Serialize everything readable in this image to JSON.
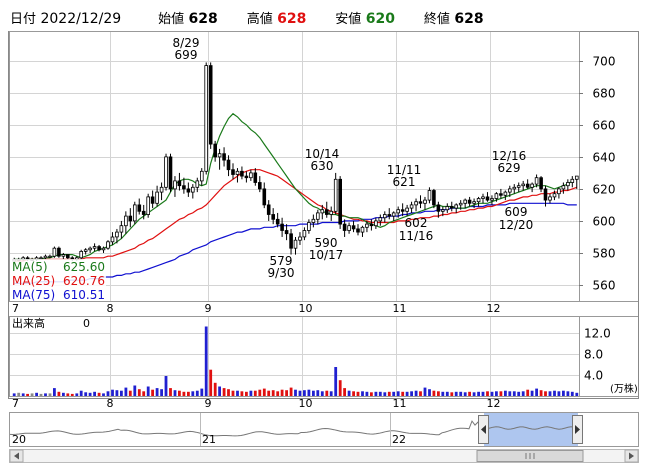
{
  "header": {
    "date_label": "日付",
    "date_value": "2022/12/29",
    "open_label": "始値",
    "open_value": "628",
    "high_label": "高値",
    "high_value": "628",
    "low_label": "安値",
    "low_value": "620",
    "close_label": "終値",
    "close_value": "628"
  },
  "colors": {
    "up": "#1e1e9a",
    "down": "#000000",
    "ma5": "#1a7a1a",
    "ma25": "#e01010",
    "ma75": "#1010d0",
    "vol_up": "#2020d0",
    "vol_down": "#e01010",
    "vol_flat": "#888888",
    "navigator_fill": "#aec6ef",
    "navigator_line": "#777777"
  },
  "legend": {
    "ma5_label": "MA(5)",
    "ma5_value": "625.60",
    "ma25_label": "MA(25)",
    "ma25_value": "620.76",
    "ma75_label": "MA(75)",
    "ma75_value": "610.51"
  },
  "volume": {
    "label": "出来高",
    "value": "0",
    "unit": "(万株)",
    "ticks": [
      "4.0",
      "8.0",
      "12.0"
    ]
  },
  "navigator": {
    "years": [
      "20",
      "21",
      "22"
    ]
  },
  "annotations": [
    {
      "id": "a-aug29",
      "date": "8/29",
      "value": "699"
    },
    {
      "id": "a-oct14",
      "date": "10/14",
      "value": "630"
    },
    {
      "id": "a-nov11",
      "date": "11/11",
      "value": "621"
    },
    {
      "id": "a-dec16",
      "date": "12/16",
      "value": "629"
    },
    {
      "id": "a-sep30",
      "date": "9/30",
      "value": "579"
    },
    {
      "id": "a-oct17",
      "date": "10/17",
      "value": "590"
    },
    {
      "id": "a-nov16",
      "date": "11/16",
      "value": "602"
    },
    {
      "id": "a-dec20",
      "date": "12/20",
      "value": "609"
    }
  ],
  "chart_data": {
    "type": "candlestick",
    "x_axis_labels": [
      "7",
      "8",
      "9",
      "10",
      "11",
      "12"
    ],
    "month_start_index": [
      0,
      22,
      44,
      65,
      86,
      107
    ],
    "y_ticks": [
      560,
      580,
      600,
      620,
      640,
      660,
      680,
      700
    ],
    "ylim": [
      550,
      718
    ],
    "grid": true,
    "candles": [
      [
        575,
        577,
        574,
        576
      ],
      [
        576,
        577,
        575,
        576
      ],
      [
        576,
        578,
        575,
        577
      ],
      [
        577,
        578,
        575,
        576
      ],
      [
        576,
        577,
        575,
        576
      ],
      [
        576,
        578,
        575,
        577
      ],
      [
        577,
        578,
        576,
        577
      ],
      [
        577,
        579,
        576,
        578
      ],
      [
        578,
        579,
        577,
        578
      ],
      [
        578,
        584,
        577,
        583
      ],
      [
        583,
        584,
        577,
        578
      ],
      [
        578,
        580,
        576,
        579
      ],
      [
        579,
        579,
        576,
        577
      ],
      [
        577,
        578,
        575,
        576
      ],
      [
        576,
        578,
        575,
        577
      ],
      [
        577,
        582,
        576,
        581
      ],
      [
        581,
        583,
        579,
        582
      ],
      [
        582,
        584,
        580,
        583
      ],
      [
        583,
        586,
        581,
        584
      ],
      [
        584,
        585,
        581,
        582
      ],
      [
        582,
        584,
        580,
        583
      ],
      [
        583,
        588,
        582,
        587
      ],
      [
        587,
        593,
        585,
        590
      ],
      [
        590,
        595,
        586,
        593
      ],
      [
        593,
        600,
        589,
        597
      ],
      [
        597,
        606,
        592,
        603
      ],
      [
        603,
        608,
        596,
        600
      ],
      [
        600,
        612,
        598,
        610
      ],
      [
        610,
        614,
        604,
        606
      ],
      [
        606,
        610,
        601,
        604
      ],
      [
        604,
        617,
        602,
        615
      ],
      [
        615,
        619,
        608,
        611
      ],
      [
        611,
        622,
        609,
        618
      ],
      [
        618,
        624,
        613,
        621
      ],
      [
        621,
        642,
        619,
        640
      ],
      [
        640,
        642,
        618,
        620
      ],
      [
        620,
        628,
        615,
        625
      ],
      [
        625,
        630,
        619,
        622
      ],
      [
        622,
        627,
        617,
        620
      ],
      [
        620,
        624,
        615,
        618
      ],
      [
        618,
        623,
        614,
        621
      ],
      [
        621,
        627,
        618,
        625
      ],
      [
        625,
        633,
        622,
        631
      ],
      [
        631,
        699,
        629,
        697
      ],
      [
        697,
        699,
        645,
        648
      ],
      [
        648,
        650,
        637,
        640
      ],
      [
        640,
        645,
        632,
        642
      ],
      [
        642,
        646,
        634,
        638
      ],
      [
        638,
        641,
        628,
        632
      ],
      [
        632,
        636,
        626,
        629
      ],
      [
        629,
        633,
        624,
        631
      ],
      [
        631,
        634,
        626,
        628
      ],
      [
        628,
        631,
        624,
        627
      ],
      [
        627,
        632,
        625,
        630
      ],
      [
        630,
        633,
        622,
        624
      ],
      [
        624,
        628,
        618,
        620
      ],
      [
        620,
        624,
        608,
        610
      ],
      [
        610,
        613,
        600,
        604
      ],
      [
        604,
        608,
        598,
        601
      ],
      [
        601,
        605,
        596,
        598
      ],
      [
        598,
        602,
        590,
        594
      ],
      [
        594,
        598,
        588,
        592
      ],
      [
        592,
        595,
        579,
        583
      ],
      [
        583,
        590,
        579,
        588
      ],
      [
        588,
        593,
        585,
        590
      ],
      [
        590,
        596,
        588,
        594
      ],
      [
        594,
        601,
        592,
        599
      ],
      [
        599,
        604,
        596,
        601
      ],
      [
        601,
        607,
        598,
        605
      ],
      [
        605,
        610,
        601,
        607
      ],
      [
        607,
        612,
        602,
        604
      ],
      [
        604,
        609,
        600,
        606
      ],
      [
        606,
        630,
        604,
        626
      ],
      [
        626,
        628,
        595,
        598
      ],
      [
        598,
        601,
        590,
        594
      ],
      [
        594,
        599,
        592,
        597
      ],
      [
        597,
        600,
        593,
        595
      ],
      [
        595,
        598,
        591,
        593
      ],
      [
        593,
        597,
        590,
        596
      ],
      [
        596,
        600,
        593,
        598
      ],
      [
        598,
        601,
        594,
        597
      ],
      [
        597,
        602,
        595,
        600
      ],
      [
        600,
        604,
        597,
        602
      ],
      [
        602,
        606,
        599,
        604
      ],
      [
        604,
        608,
        601,
        603
      ],
      [
        603,
        606,
        600,
        605
      ],
      [
        605,
        609,
        602,
        607
      ],
      [
        607,
        611,
        603,
        606
      ],
      [
        606,
        610,
        603,
        608
      ],
      [
        608,
        612,
        605,
        610
      ],
      [
        610,
        614,
        606,
        612
      ],
      [
        612,
        616,
        608,
        611
      ],
      [
        611,
        615,
        607,
        613
      ],
      [
        613,
        621,
        611,
        619
      ],
      [
        619,
        620,
        608,
        610
      ],
      [
        610,
        612,
        602,
        606
      ],
      [
        606,
        609,
        603,
        607
      ],
      [
        607,
        611,
        605,
        609
      ],
      [
        609,
        612,
        606,
        608
      ],
      [
        608,
        611,
        605,
        610
      ],
      [
        610,
        613,
        607,
        611
      ],
      [
        611,
        614,
        608,
        613
      ],
      [
        613,
        615,
        609,
        611
      ],
      [
        611,
        614,
        608,
        612
      ],
      [
        612,
        615,
        609,
        614
      ],
      [
        614,
        617,
        611,
        615
      ],
      [
        615,
        618,
        612,
        613
      ],
      [
        613,
        616,
        610,
        614
      ],
      [
        614,
        618,
        612,
        617
      ],
      [
        617,
        620,
        614,
        616
      ],
      [
        616,
        619,
        613,
        618
      ],
      [
        618,
        622,
        615,
        620
      ],
      [
        620,
        623,
        617,
        621
      ],
      [
        621,
        624,
        618,
        622
      ],
      [
        622,
        625,
        619,
        623
      ],
      [
        623,
        626,
        620,
        621
      ],
      [
        621,
        624,
        618,
        623
      ],
      [
        623,
        629,
        621,
        627
      ],
      [
        627,
        628,
        618,
        620
      ],
      [
        620,
        622,
        609,
        613
      ],
      [
        613,
        617,
        611,
        615
      ],
      [
        615,
        619,
        613,
        617
      ],
      [
        617,
        621,
        614,
        620
      ],
      [
        620,
        624,
        617,
        622
      ],
      [
        622,
        626,
        619,
        624
      ],
      [
        624,
        628,
        621,
        626
      ],
      [
        626,
        628,
        620,
        628
      ]
    ],
    "ma5": [
      576,
      576,
      576,
      576,
      576,
      576,
      576,
      577,
      577,
      578,
      579,
      579,
      579,
      579,
      578,
      577,
      578,
      579,
      581,
      582,
      583,
      584,
      585,
      587,
      589,
      592,
      595,
      598,
      601,
      603,
      605,
      607,
      609,
      611,
      613,
      618,
      623,
      625,
      626,
      626,
      625,
      623,
      622,
      623,
      636,
      645,
      653,
      659,
      664,
      667,
      665,
      662,
      660,
      657,
      655,
      652,
      648,
      644,
      640,
      636,
      632,
      628,
      624,
      620,
      617,
      614,
      611,
      609,
      608,
      606,
      605,
      604,
      604,
      603,
      603,
      602,
      602,
      602,
      601,
      599,
      598,
      597,
      596,
      597,
      599,
      600,
      601,
      602,
      603,
      604,
      605,
      606,
      607,
      608,
      609,
      610,
      609,
      609,
      609,
      608,
      608,
      608,
      609,
      610,
      611,
      611,
      611,
      612,
      613,
      614,
      615,
      616,
      617,
      618,
      619,
      620,
      621,
      622,
      622,
      622,
      621,
      620,
      621,
      622,
      623,
      625
    ],
    "ma25": [
      575,
      575,
      575,
      576,
      576,
      576,
      576,
      576,
      576,
      576,
      576,
      576,
      576,
      576,
      576,
      576,
      577,
      577,
      577,
      577,
      577,
      578,
      578,
      579,
      580,
      581,
      582,
      583,
      585,
      586,
      588,
      589,
      591,
      593,
      595,
      597,
      599,
      601,
      602,
      604,
      605,
      607,
      608,
      610,
      613,
      616,
      619,
      622,
      624,
      626,
      628,
      630,
      631,
      632,
      632,
      632,
      631,
      630,
      629,
      628,
      626,
      624,
      622,
      620,
      618,
      616,
      614,
      612,
      610,
      609,
      607,
      606,
      605,
      604,
      603,
      602,
      601,
      601,
      600,
      600,
      599,
      599,
      599,
      599,
      599,
      599,
      600,
      600,
      600,
      601,
      601,
      602,
      602,
      602,
      603,
      603,
      604,
      604,
      605,
      605,
      606,
      606,
      607,
      607,
      608,
      608,
      609,
      609,
      610,
      611,
      612,
      613,
      613,
      614,
      615,
      615,
      616,
      616,
      617,
      617,
      617,
      618,
      618,
      619,
      619,
      620,
      621
    ],
    "ma75": [
      561,
      561,
      561,
      561,
      561,
      562,
      562,
      562,
      562,
      562,
      562,
      562,
      563,
      563,
      563,
      563,
      563,
      564,
      564,
      564,
      565,
      565,
      565,
      566,
      566,
      567,
      567,
      568,
      568,
      569,
      570,
      571,
      572,
      573,
      574,
      575,
      576,
      578,
      579,
      580,
      582,
      583,
      584,
      585,
      587,
      588,
      589,
      590,
      591,
      592,
      593,
      593,
      594,
      595,
      595,
      595,
      596,
      596,
      596,
      597,
      597,
      597,
      597,
      597,
      598,
      598,
      598,
      598,
      598,
      599,
      599,
      599,
      599,
      599,
      600,
      600,
      600,
      600,
      601,
      601,
      601,
      602,
      602,
      602,
      603,
      603,
      603,
      604,
      604,
      605,
      605,
      605,
      606,
      606,
      606,
      607,
      607,
      607,
      608,
      608,
      608,
      608,
      609,
      609,
      609,
      609,
      610,
      610,
      610,
      610,
      610,
      611,
      611,
      611,
      611,
      611,
      611,
      611,
      611,
      611,
      611,
      611,
      611,
      611,
      610,
      610,
      610
    ],
    "volume": [
      0.5,
      0.6,
      0.5,
      0.4,
      0.5,
      0.6,
      0.4,
      0.5,
      0.5,
      1.5,
      0.8,
      0.6,
      0.5,
      0.4,
      0.5,
      1.0,
      0.7,
      0.6,
      0.8,
      0.6,
      0.5,
      0.9,
      1.2,
      1.1,
      1.0,
      1.6,
      1.0,
      2.0,
      1.3,
      0.9,
      1.8,
      1.2,
      1.5,
      1.3,
      3.8,
      1.5,
      1.1,
      1.0,
      0.8,
      0.8,
      0.9,
      1.0,
      1.4,
      13.2,
      5.0,
      2.5,
      1.8,
      1.5,
      1.3,
      1.0,
      1.0,
      0.9,
      0.8,
      1.0,
      1.0,
      1.2,
      1.4,
      1.0,
      1.1,
      0.9,
      1.2,
      1.1,
      1.6,
      1.2,
      1.0,
      1.1,
      1.2,
      1.0,
      1.1,
      0.9,
      1.0,
      0.9,
      5.5,
      3.0,
      1.5,
      1.0,
      0.9,
      0.8,
      0.9,
      0.8,
      0.7,
      0.8,
      0.8,
      0.7,
      0.8,
      0.8,
      0.9,
      0.8,
      0.8,
      0.9,
      1.0,
      0.9,
      1.6,
      1.3,
      1.0,
      0.9,
      0.8,
      0.8,
      0.7,
      0.8,
      0.8,
      0.7,
      0.8,
      0.7,
      0.8,
      0.8,
      0.9,
      0.8,
      0.9,
      0.9,
      1.0,
      0.9,
      0.9,
      0.8,
      0.9,
      1.2,
      1.0,
      1.4,
      1.1,
      0.9,
      0.9,
      1.0,
      0.9,
      1.0,
      0.9,
      0.8,
      0.6
    ],
    "volume_ylim": [
      0,
      15
    ],
    "volume_ticks": [
      4.0,
      8.0,
      12.0
    ]
  }
}
